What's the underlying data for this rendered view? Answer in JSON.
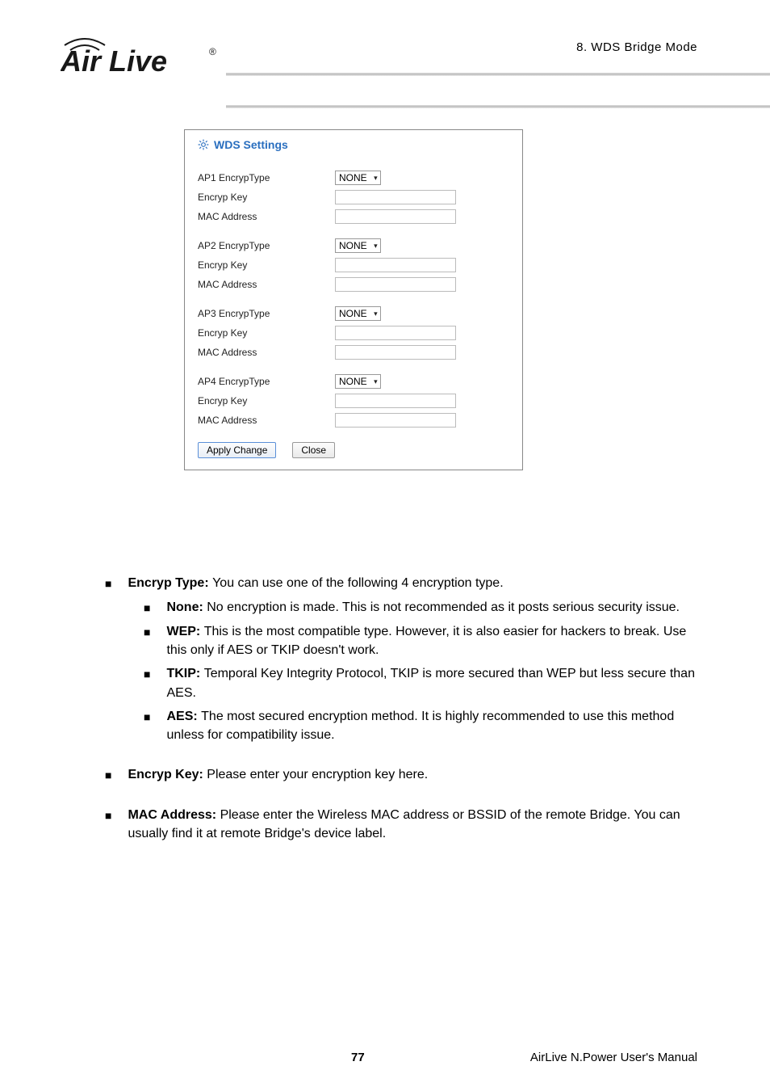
{
  "header": {
    "chapter": "8.  WDS  Bridge  Mode",
    "logo_brand": "AirLive"
  },
  "panel": {
    "title": "WDS Settings",
    "aps": [
      {
        "encrypTypeLabel": "AP1 EncrypType",
        "encrypKeyLabel": "Encryp Key",
        "macLabel": "MAC Address",
        "encrypTypeValue": "NONE"
      },
      {
        "encrypTypeLabel": "AP2 EncrypType",
        "encrypKeyLabel": "Encryp Key",
        "macLabel": "MAC Address",
        "encrypTypeValue": "NONE"
      },
      {
        "encrypTypeLabel": "AP3 EncrypType",
        "encrypKeyLabel": "Encryp Key",
        "macLabel": "MAC Address",
        "encrypTypeValue": "NONE"
      },
      {
        "encrypTypeLabel": "AP4 EncrypType",
        "encrypKeyLabel": "Encryp Key",
        "macLabel": "MAC Address",
        "encrypTypeValue": "NONE"
      }
    ],
    "applyBtn": "Apply Change",
    "closeBtn": "Close"
  },
  "bullets": {
    "encrypType": {
      "head": "Encryp Type: ",
      "text": "You can use one of the following 4 encryption type."
    },
    "none": {
      "head": "None: ",
      "text": "No encryption is made.    This is not recommended as it posts serious security issue."
    },
    "wep": {
      "head": "WEP: ",
      "text": "This is the most compatible type.    However, it is also easier for hackers to break.    Use this only if AES or TKIP doesn't work."
    },
    "tkip": {
      "head": "TKIP: ",
      "text": "Temporal Key Integrity Protocol, TKIP is more secured than WEP but less secure than AES."
    },
    "aes": {
      "head": "AES: ",
      "text": "The most secured encryption method.    It is highly recommended to use this method unless for compatibility issue."
    },
    "encrypKey": {
      "head": "Encryp Key: ",
      "text": "Please enter your encryption key here."
    },
    "mac": {
      "head": "MAC Address:   ",
      "text": "Please enter the Wireless MAC address or BSSID of the remote Bridge.    You can usually find it at remote Bridge's device label."
    }
  },
  "footer": {
    "page": "77",
    "manual": "AirLive N.Power User's Manual"
  }
}
